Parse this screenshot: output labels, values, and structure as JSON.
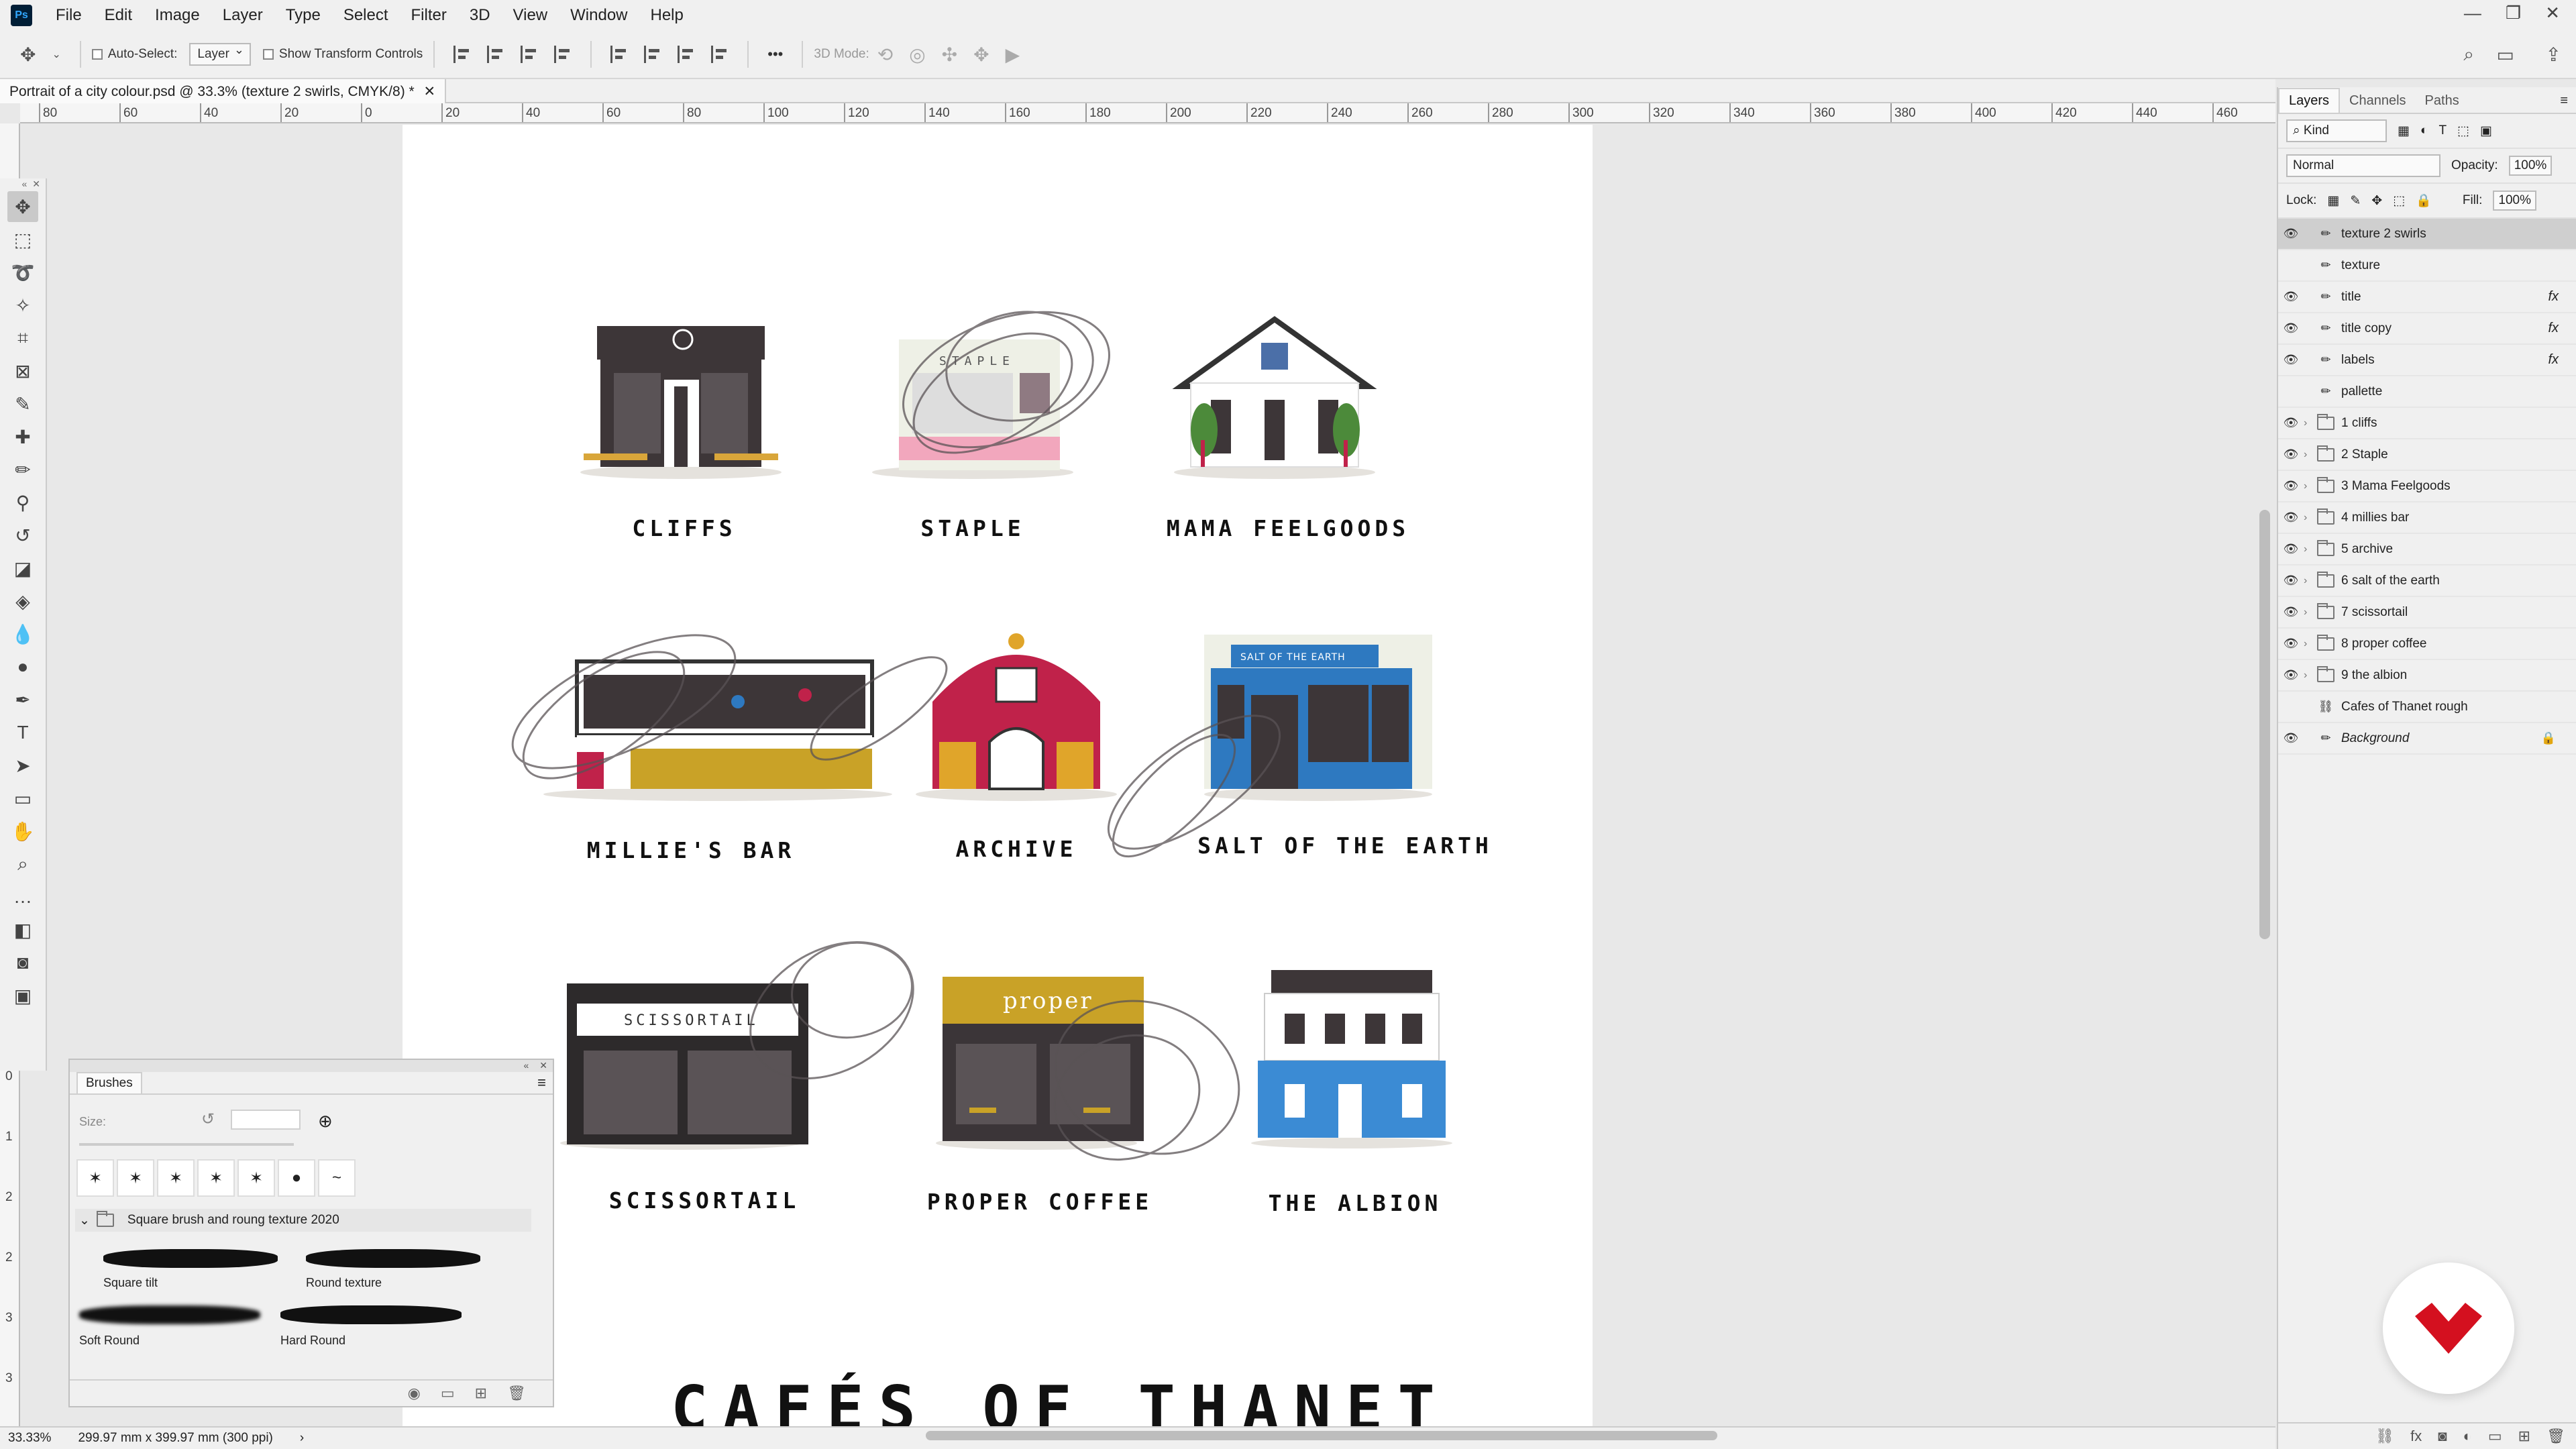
{
  "app": {
    "logo": "Ps"
  },
  "menu": [
    "File",
    "Edit",
    "Image",
    "Layer",
    "Type",
    "Select",
    "Filter",
    "3D",
    "View",
    "Window",
    "Help"
  ],
  "window_controls": {
    "minimize": "—",
    "restore": "❐",
    "close": "✕"
  },
  "options": {
    "auto_select_label": "Auto-Select:",
    "auto_select_value": "Layer",
    "show_transform_label": "Show Transform Controls",
    "more": "•••",
    "mode_3d_label": "3D Mode:"
  },
  "document": {
    "tab_title": "Portrait of a city colour.psd @ 33.3% (texture 2 swirls, CMYK/8) *"
  },
  "ruler_h": [
    "80",
    "60",
    "40",
    "20",
    "0",
    "20",
    "40",
    "60",
    "80",
    "100",
    "120",
    "140",
    "160",
    "180",
    "200",
    "220",
    "240",
    "260",
    "280",
    "300",
    "320",
    "340",
    "360",
    "380",
    "400",
    "420",
    "440",
    "460"
  ],
  "ruler_v": [
    "0",
    "1",
    "2",
    "2",
    "3",
    "3"
  ],
  "cafes": [
    {
      "name": "CLIFFS",
      "color": "#3d3638",
      "accent": "#d9a63a"
    },
    {
      "name": "STAPLE",
      "color": "#eef0e6",
      "accent": "#f2a7bd"
    },
    {
      "name": "MAMA FEELGOODS",
      "color": "#ffffff",
      "accent": "#4b6fa8"
    },
    {
      "name": "MILLIE'S BAR",
      "color": "#ffffff",
      "accent": "#c9a227"
    },
    {
      "name": "ARCHIVE",
      "color": "#c0224a",
      "accent": "#e0a52a"
    },
    {
      "name": "SALT OF THE EARTH",
      "color": "#2e79c0",
      "accent": "#2e79c0"
    },
    {
      "name": "SCISSORTAIL",
      "color": "#2d2a2b",
      "accent": "#ffffff"
    },
    {
      "name": "PROPER COFFEE",
      "color": "#3b3538",
      "accent": "#c9a227"
    },
    {
      "name": "THE ALBION",
      "color": "#3b8bd4",
      "accent": "#ffffff"
    }
  ],
  "signs": {
    "staple": "STAPLE",
    "salt": "SALT OF THE EARTH",
    "scissortail": "SCISSORTAIL",
    "proper": "proper"
  },
  "poster_title": "CAFÉS OF THANET",
  "brushes": {
    "panel_title": "Brushes",
    "size_label": "Size:",
    "group_name": "Square brush and roung texture 2020",
    "items": [
      "Square tilt",
      "Round texture",
      "Soft Round",
      "Hard Round"
    ]
  },
  "layers_panel": {
    "tabs": [
      "Layers",
      "Channels",
      "Paths"
    ],
    "filter_kind": "Kind",
    "blend_mode": "Normal",
    "opacity_label": "Opacity:",
    "opacity_value": "100%",
    "lock_label": "Lock:",
    "fill_label": "Fill:",
    "fill_value": "100%",
    "layers": [
      {
        "name": "texture 2 swirls",
        "visible": true,
        "selected": true,
        "kind": "brush",
        "fx": "",
        "italic": false
      },
      {
        "name": "texture",
        "visible": false,
        "kind": "brush",
        "fx": ""
      },
      {
        "name": "title",
        "visible": true,
        "kind": "brush",
        "fx": "fx"
      },
      {
        "name": "title copy",
        "visible": true,
        "kind": "brush",
        "fx": "fx"
      },
      {
        "name": "labels",
        "visible": true,
        "kind": "brush",
        "fx": "fx"
      },
      {
        "name": "pallette",
        "visible": false,
        "kind": "brush",
        "fx": ""
      },
      {
        "name": "1 cliffs",
        "visible": true,
        "kind": "folder",
        "fx": ""
      },
      {
        "name": "2 Staple",
        "visible": true,
        "kind": "folder",
        "fx": ""
      },
      {
        "name": "3 Mama Feelgoods",
        "visible": true,
        "kind": "folder",
        "fx": ""
      },
      {
        "name": "4 millies bar",
        "visible": true,
        "kind": "folder",
        "fx": ""
      },
      {
        "name": "5 archive",
        "visible": true,
        "kind": "folder",
        "fx": ""
      },
      {
        "name": "6 salt of the earth",
        "visible": true,
        "kind": "folder",
        "fx": ""
      },
      {
        "name": "7 scissortail",
        "visible": true,
        "kind": "folder",
        "fx": ""
      },
      {
        "name": "8 proper coffee",
        "visible": true,
        "kind": "folder",
        "fx": ""
      },
      {
        "name": "9 the albion",
        "visible": true,
        "kind": "folder",
        "fx": ""
      },
      {
        "name": "Cafes of Thanet rough",
        "visible": false,
        "kind": "link",
        "fx": ""
      },
      {
        "name": "Background",
        "visible": true,
        "kind": "brush",
        "fx": "",
        "locked": true,
        "italic": true
      }
    ]
  },
  "status": {
    "zoom": "33.33%",
    "doc_size": "299.97 mm x 399.97 mm (300 ppi)"
  }
}
